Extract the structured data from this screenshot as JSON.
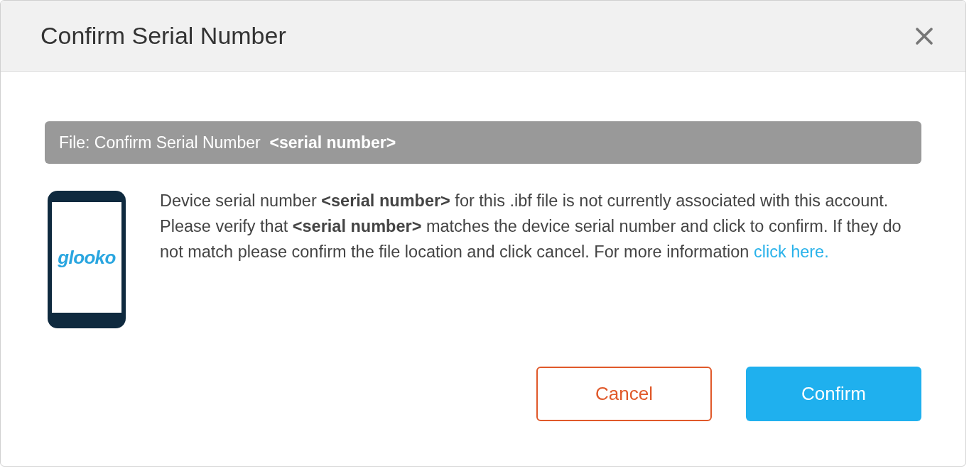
{
  "dialog": {
    "title": "Confirm Serial Number",
    "file_bar": "File: Confirm Serial Number  **<serial number>**",
    "device": {
      "logo_text": "glooko"
    },
    "message": {
      "text": "Device serial number **<serial number>** for this .ibf file is not currently associated with this account. Please verify that **<serial number>** matches the device serial number and click to confirm. If they do not match please confirm the file location and click cancel. For more information ",
      "link": "click here."
    },
    "buttons": [
      {
        "label": "Cancel",
        "kind": "secondary"
      },
      {
        "label": "Confirm",
        "kind": "primary"
      }
    ]
  }
}
